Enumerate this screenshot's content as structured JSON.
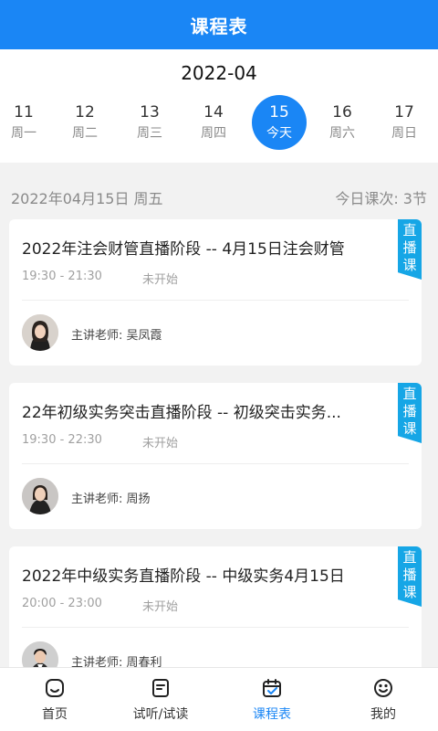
{
  "header": {
    "title": "课程表"
  },
  "calendar": {
    "month": "2022-04",
    "days": [
      {
        "num": "11",
        "label": "周一"
      },
      {
        "num": "12",
        "label": "周二"
      },
      {
        "num": "13",
        "label": "周三"
      },
      {
        "num": "14",
        "label": "周四"
      },
      {
        "num": "15",
        "label": "今天"
      },
      {
        "num": "16",
        "label": "周六"
      },
      {
        "num": "17",
        "label": "周日"
      }
    ]
  },
  "summary": {
    "date": "2022年04月15日  周五",
    "count": "今日课次:  3节"
  },
  "courses": [
    {
      "title": "2022年注会财管直播阶段 -- 4月15日注会财管",
      "time": "19:30 - 21:30",
      "status": "未开始",
      "teacher": "主讲老师:  吴凤霞",
      "badge": "直播课"
    },
    {
      "title": "22年初级实务突击直播阶段 -- 初级突击实务...",
      "time": "19:30 - 22:30",
      "status": "未开始",
      "teacher": "主讲老师:  周扬",
      "badge": "直播课"
    },
    {
      "title": "2022年中级实务直播阶段 -- 中级实务4月15日",
      "time": "20:00 - 23:00",
      "status": "未开始",
      "teacher": "主讲老师:  周春利",
      "badge": "直播课"
    }
  ],
  "tabbar": {
    "home": "首页",
    "trial": "试听/试读",
    "schedule": "课程表",
    "mine": "我的"
  },
  "colors": {
    "accent": "#1a86f5",
    "badge": "#16a6e6"
  }
}
